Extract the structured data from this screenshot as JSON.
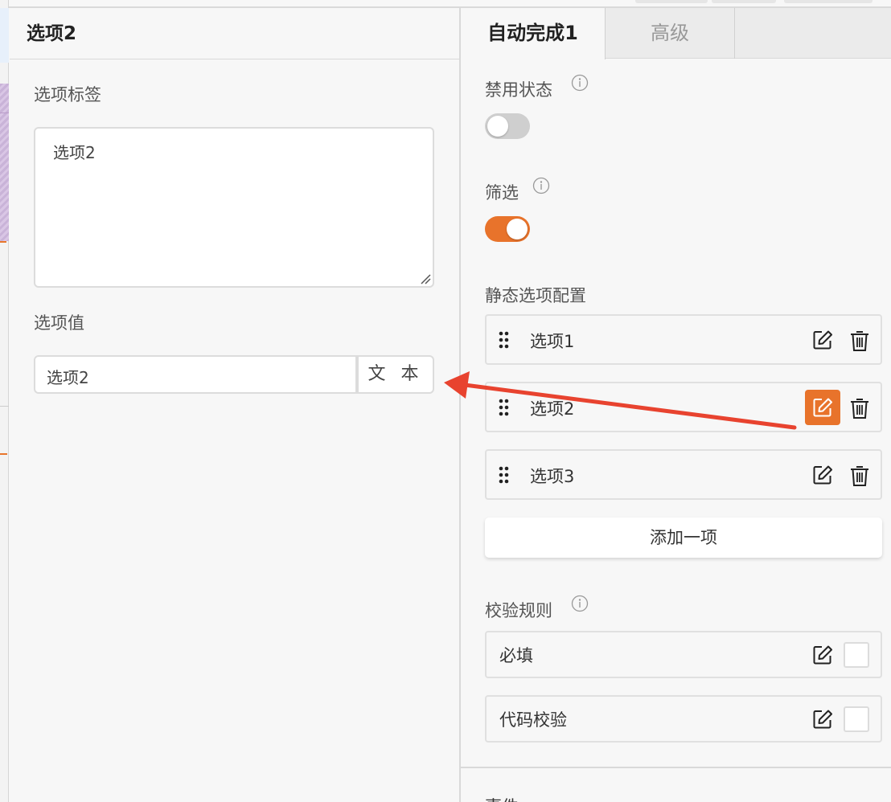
{
  "left_panel": {
    "title": "选项2",
    "label_field": {
      "label": "选项标签",
      "value": "选项2"
    },
    "value_field": {
      "label": "选项值",
      "value": "选项2",
      "type_button": "文 本"
    }
  },
  "right_panel": {
    "tabs": [
      {
        "label": "自动完成1",
        "active": true
      },
      {
        "label": "高级",
        "active": false
      }
    ],
    "disabled": {
      "label": "禁用状态",
      "on": false
    },
    "filter": {
      "label": "筛选",
      "on": true
    },
    "static_options": {
      "label": "静态选项配置",
      "items": [
        {
          "label": "选项1",
          "editing": false
        },
        {
          "label": "选项2",
          "editing": true
        },
        {
          "label": "选项3",
          "editing": false
        }
      ],
      "add_button": "添加一项"
    },
    "validation": {
      "label": "校验规则",
      "rules": [
        {
          "label": "必填",
          "checked": false
        },
        {
          "label": "代码校验",
          "checked": false
        }
      ]
    },
    "next_section_label": "事件"
  },
  "colors": {
    "accent": "#e8732b",
    "annotation_arrow": "#e8432f"
  },
  "icons": [
    "info-icon",
    "drag-handle-icon",
    "edit-icon",
    "trash-icon",
    "resize-grip-icon",
    "chevron-icon"
  ]
}
